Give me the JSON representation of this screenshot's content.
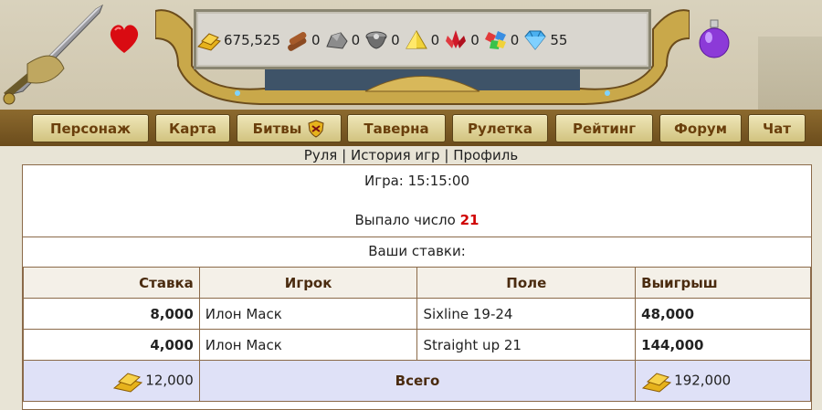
{
  "resources": [
    {
      "icon": "gold-icon",
      "value": "675,525"
    },
    {
      "icon": "wood-icon",
      "value": "0"
    },
    {
      "icon": "stone-icon",
      "value": "0"
    },
    {
      "icon": "iron-icon",
      "value": "0"
    },
    {
      "icon": "sulfur-icon",
      "value": "0"
    },
    {
      "icon": "crystal-icon",
      "value": "0"
    },
    {
      "icon": "gems-icon",
      "value": "0"
    },
    {
      "icon": "diamond-icon",
      "value": "55"
    }
  ],
  "nav": {
    "character": "Персонаж",
    "map": "Карта",
    "battles": "Битвы",
    "tavern": "Таверна",
    "roulette": "Рулетка",
    "rating": "Рейтинг",
    "forum": "Форум",
    "chat": "Чат"
  },
  "sublinks": {
    "roulette": "Руля",
    "sep1": "|",
    "history": "История игр",
    "sep2": "|",
    "profile": "Профиль"
  },
  "game": {
    "time_label": "Игра: 15:15:00",
    "result_label": "Выпало число",
    "result_number": "21",
    "bets_title": "Ваши ставки:"
  },
  "table": {
    "headers": {
      "stake": "Ставка",
      "player": "Игрок",
      "field": "Поле",
      "win": "Выигрыш"
    },
    "rows": [
      {
        "stake": "8,000",
        "player": "Илон Маск",
        "field": "Sixline 19-24",
        "win": "48,000"
      },
      {
        "stake": "4,000",
        "player": "Илон Маск",
        "field": "Straight up 21",
        "win": "144,000"
      }
    ],
    "total": {
      "stake": "12,000",
      "label": "Всего",
      "win": "192,000"
    }
  },
  "colors": {
    "accent": "#6a3f0c",
    "result": "#d00000",
    "total_bg": "#dfe1f7"
  }
}
